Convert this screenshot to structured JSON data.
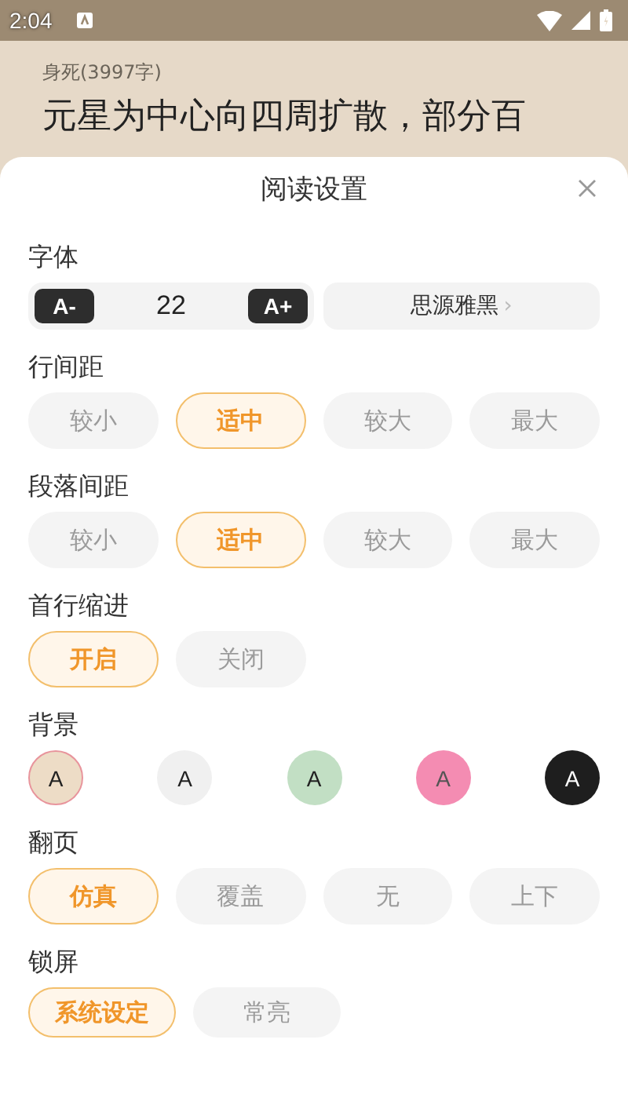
{
  "status_bar": {
    "time": "2:04"
  },
  "book": {
    "chapter": "身死(3997字)",
    "text": "元星为中心向四周扩散，部分百"
  },
  "sheet": {
    "title": "阅读设置",
    "font": {
      "label": "字体",
      "decrease": "A-",
      "size": "22",
      "increase": "A+",
      "family": "思源雅黑",
      "family_arrow": "›"
    },
    "line_spacing": {
      "label": "行间距",
      "options": [
        {
          "label": "较小",
          "selected": false
        },
        {
          "label": "适中",
          "selected": true
        },
        {
          "label": "较大",
          "selected": false
        },
        {
          "label": "最大",
          "selected": false
        }
      ]
    },
    "paragraph_spacing": {
      "label": "段落间距",
      "options": [
        {
          "label": "较小",
          "selected": false
        },
        {
          "label": "适中",
          "selected": true
        },
        {
          "label": "较大",
          "selected": false
        },
        {
          "label": "最大",
          "selected": false
        }
      ]
    },
    "indent": {
      "label": "首行缩进",
      "options": [
        {
          "label": "开启",
          "selected": true
        },
        {
          "label": "关闭",
          "selected": false
        }
      ]
    },
    "background": {
      "label": "背景",
      "options": [
        {
          "label": "A",
          "color": "#eddcc6",
          "selected": true
        },
        {
          "label": "A",
          "color": "#f0f0f0",
          "selected": false
        },
        {
          "label": "A",
          "color": "#c2dfc4",
          "selected": false
        },
        {
          "label": "A",
          "color": "#f48cb2",
          "selected": false
        },
        {
          "label": "A",
          "color": "#1e1e1e",
          "selected": false
        }
      ]
    },
    "page_turn": {
      "label": "翻页",
      "options": [
        {
          "label": "仿真",
          "selected": true
        },
        {
          "label": "覆盖",
          "selected": false
        },
        {
          "label": "无",
          "selected": false
        },
        {
          "label": "上下",
          "selected": false
        }
      ]
    },
    "lock_screen": {
      "label": "锁屏",
      "options": [
        {
          "label": "系统设定",
          "selected": true
        },
        {
          "label": "常亮",
          "selected": false
        }
      ]
    }
  }
}
